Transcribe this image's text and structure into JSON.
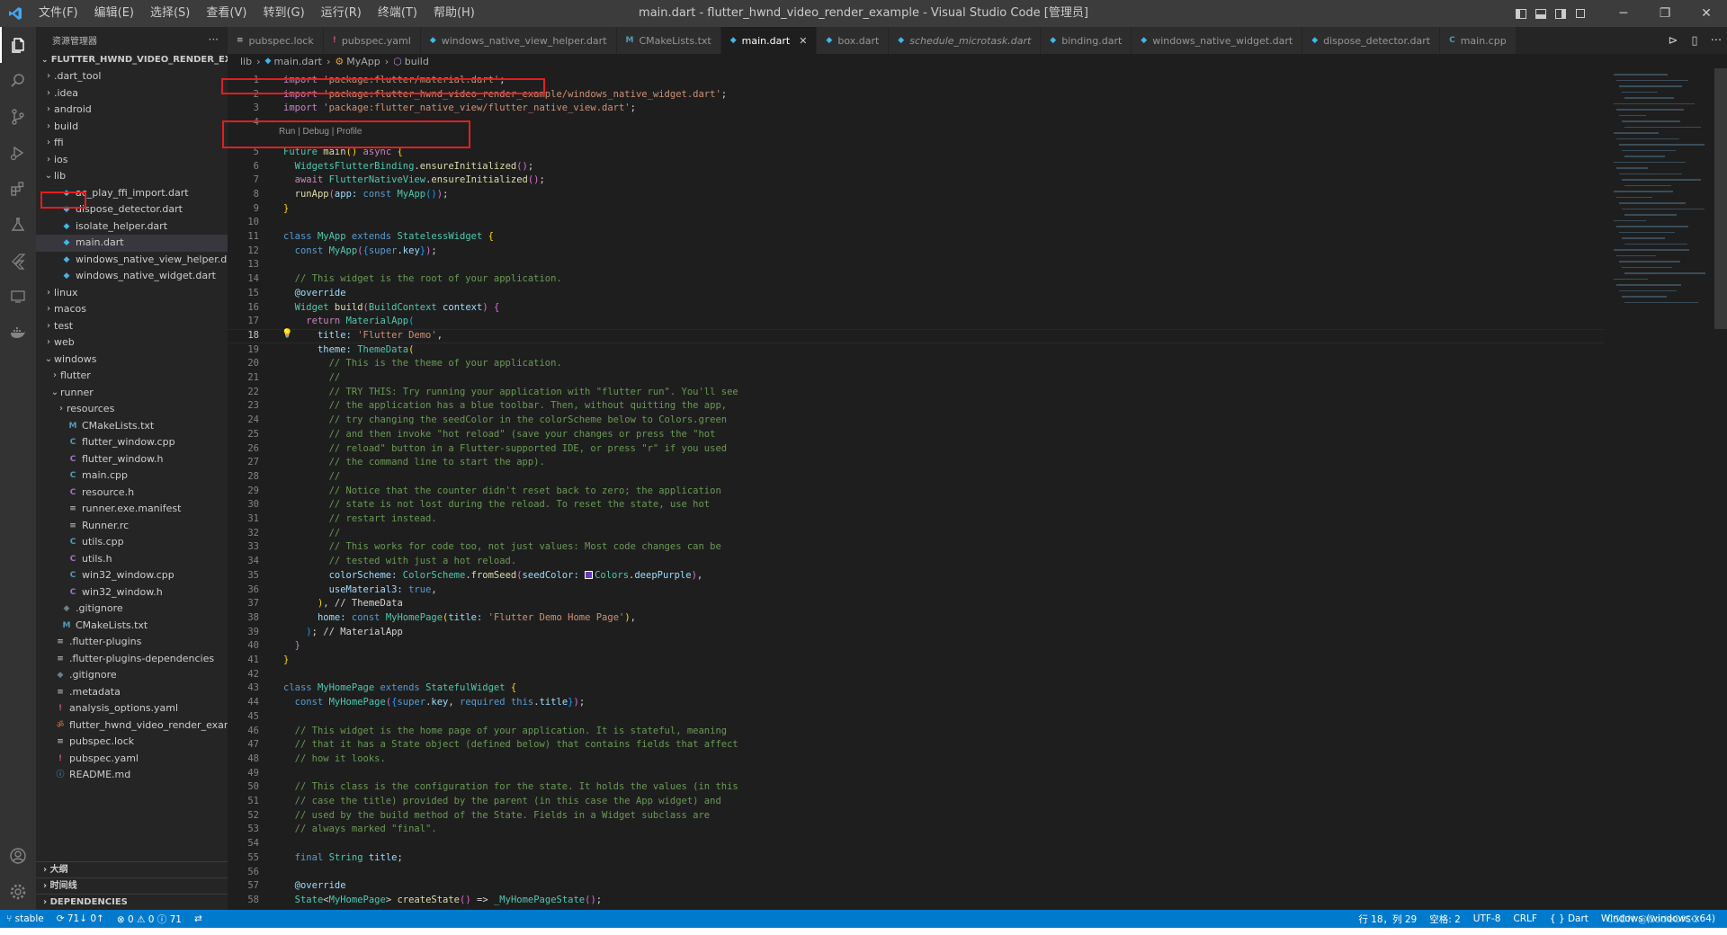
{
  "window": {
    "title": "main.dart - flutter_hwnd_video_render_example - Visual Studio Code [管理员]",
    "menu": [
      "文件(F)",
      "编辑(E)",
      "选择(S)",
      "查看(V)",
      "转到(G)",
      "运行(R)",
      "终端(T)",
      "帮助(H)"
    ],
    "controls": {
      "minimize": "─",
      "restore": "❐",
      "close": "✕"
    }
  },
  "activity_bar": {
    "top": [
      "explorer-icon",
      "search-icon",
      "source-control-icon",
      "run-debug-icon",
      "extensions-icon",
      "testing-icon",
      "flutter-icon",
      "remote-explorer-icon",
      "docker-icon"
    ],
    "bottom": [
      "account-icon",
      "settings-icon"
    ]
  },
  "sidebar": {
    "header": "资源管理器",
    "header_action": "···",
    "root": "FLUTTER_HWND_VIDEO_RENDER_EXAMPLE",
    "tree": [
      {
        "label": ".dart_tool",
        "depth": 0,
        "type": "folder",
        "open": false
      },
      {
        "label": ".idea",
        "depth": 0,
        "type": "folder",
        "open": false
      },
      {
        "label": "android",
        "depth": 0,
        "type": "folder",
        "open": false
      },
      {
        "label": "build",
        "depth": 0,
        "type": "folder",
        "open": false
      },
      {
        "label": "ffi",
        "depth": 0,
        "type": "folder",
        "open": false
      },
      {
        "label": "ios",
        "depth": 0,
        "type": "folder",
        "open": false
      },
      {
        "label": "lib",
        "depth": 0,
        "type": "folder",
        "open": true
      },
      {
        "label": "ac_play_ffi_import.dart",
        "depth": 1,
        "type": "dart"
      },
      {
        "label": "dispose_detector.dart",
        "depth": 1,
        "type": "dart"
      },
      {
        "label": "isolate_helper.dart",
        "depth": 1,
        "type": "dart"
      },
      {
        "label": "main.dart",
        "depth": 1,
        "type": "dart",
        "selected": true
      },
      {
        "label": "windows_native_view_helper.dart",
        "depth": 1,
        "type": "dart"
      },
      {
        "label": "windows_native_widget.dart",
        "depth": 1,
        "type": "dart"
      },
      {
        "label": "linux",
        "depth": 0,
        "type": "folder",
        "open": false
      },
      {
        "label": "macos",
        "depth": 0,
        "type": "folder",
        "open": false
      },
      {
        "label": "test",
        "depth": 0,
        "type": "folder",
        "open": false
      },
      {
        "label": "web",
        "depth": 0,
        "type": "folder",
        "open": false
      },
      {
        "label": "windows",
        "depth": 0,
        "type": "folder",
        "open": true
      },
      {
        "label": "flutter",
        "depth": 1,
        "type": "folder",
        "open": false
      },
      {
        "label": "runner",
        "depth": 1,
        "type": "folder",
        "open": true
      },
      {
        "label": "resources",
        "depth": 2,
        "type": "folder",
        "open": false
      },
      {
        "label": "CMakeLists.txt",
        "depth": 2,
        "type": "cmake"
      },
      {
        "label": "flutter_window.cpp",
        "depth": 2,
        "type": "cpp"
      },
      {
        "label": "flutter_window.h",
        "depth": 2,
        "type": "h"
      },
      {
        "label": "main.cpp",
        "depth": 2,
        "type": "cpp"
      },
      {
        "label": "resource.h",
        "depth": 2,
        "type": "h"
      },
      {
        "label": "runner.exe.manifest",
        "depth": 2,
        "type": "txt"
      },
      {
        "label": "Runner.rc",
        "depth": 2,
        "type": "txt"
      },
      {
        "label": "utils.cpp",
        "depth": 2,
        "type": "cpp"
      },
      {
        "label": "utils.h",
        "depth": 2,
        "type": "h"
      },
      {
        "label": "win32_window.cpp",
        "depth": 2,
        "type": "cpp"
      },
      {
        "label": "win32_window.h",
        "depth": 2,
        "type": "h"
      },
      {
        "label": ".gitignore",
        "depth": 1,
        "type": "git"
      },
      {
        "label": "CMakeLists.txt",
        "depth": 1,
        "type": "cmake"
      },
      {
        "label": ".flutter-plugins",
        "depth": 0,
        "type": "txt"
      },
      {
        "label": ".flutter-plugins-dependencies",
        "depth": 0,
        "type": "txt"
      },
      {
        "label": ".gitignore",
        "depth": 0,
        "type": "git"
      },
      {
        "label": ".metadata",
        "depth": 0,
        "type": "txt"
      },
      {
        "label": "analysis_options.yaml",
        "depth": 0,
        "type": "yaml"
      },
      {
        "label": "flutter_hwnd_video_render_example.i...",
        "depth": 0,
        "type": "rss"
      },
      {
        "label": "pubspec.lock",
        "depth": 0,
        "type": "txt"
      },
      {
        "label": "pubspec.yaml",
        "depth": 0,
        "type": "yaml"
      },
      {
        "label": "README.md",
        "depth": 0,
        "type": "info"
      }
    ],
    "sections": [
      "大纲",
      "时间线",
      "DEPENDENCIES"
    ]
  },
  "tabs": [
    {
      "label": "pubspec.lock",
      "icon": "txt"
    },
    {
      "label": "pubspec.yaml",
      "icon": "yaml"
    },
    {
      "label": "windows_native_view_helper.dart",
      "icon": "dart"
    },
    {
      "label": "CMakeLists.txt",
      "icon": "cmake"
    },
    {
      "label": "main.dart",
      "icon": "dart",
      "active": true
    },
    {
      "label": "box.dart",
      "icon": "dart"
    },
    {
      "label": "schedule_microtask.dart",
      "icon": "dart",
      "italic": true
    },
    {
      "label": "binding.dart",
      "icon": "dart"
    },
    {
      "label": "windows_native_widget.dart",
      "icon": "dart"
    },
    {
      "label": "dispose_detector.dart",
      "icon": "dart"
    },
    {
      "label": "main.cpp",
      "icon": "cpp"
    }
  ],
  "breadcrumb": [
    "lib",
    "main.dart",
    "MyApp",
    "build"
  ],
  "editor": {
    "codelens": "Run | Debug | Profile",
    "current_line": 18,
    "lines": [
      {
        "n": 1,
        "html": "<span class=\"kc\">import</span> <span class=\"s\">'package:flutter/material.dart'</span><span class=\"d\">;</span>"
      },
      {
        "n": 2,
        "html": "<span class=\"kc\">import</span> <span class=\"s\">'package:flutter_hwnd_video_render_example/windows_native_widget.dart'</span><span class=\"d\">;</span>"
      },
      {
        "n": 3,
        "html": "<span class=\"kc\">import</span> <span class=\"s\">'package:flutter_native_view/flutter_native_view.dart'</span><span class=\"d\">;</span>"
      },
      {
        "n": 4,
        "html": ""
      },
      {
        "n": 5,
        "html": "<span class=\"t\">Future</span> <span class=\"f\">main</span><span class=\"b1\">()</span> <span class=\"kc\">async</span> <span class=\"b1\">{</span>"
      },
      {
        "n": 6,
        "html": "  <span class=\"t\">WidgetsFlutterBinding</span><span class=\"d\">.</span><span class=\"f\">ensureInitialized</span><span class=\"b2\">()</span><span class=\"d\">;</span>"
      },
      {
        "n": 7,
        "html": "  <span class=\"kc\">await</span> <span class=\"t\">FlutterNativeView</span><span class=\"d\">.</span><span class=\"f\">ensureInitialized</span><span class=\"b2\">()</span><span class=\"d\">;</span>"
      },
      {
        "n": 8,
        "html": "  <span class=\"f\">runApp</span><span class=\"b2\">(</span><span class=\"p\">app:</span> <span class=\"k\">const</span> <span class=\"t\">MyApp</span><span class=\"b3\">()</span><span class=\"b2\">)</span><span class=\"d\">;</span>"
      },
      {
        "n": 9,
        "html": "<span class=\"b1\">}</span>"
      },
      {
        "n": 10,
        "html": ""
      },
      {
        "n": 11,
        "html": "<span class=\"k\">class</span> <span class=\"t\">MyApp</span> <span class=\"k\">extends</span> <span class=\"t\">StatelessWidget</span> <span class=\"b1\">{</span>"
      },
      {
        "n": 12,
        "html": "  <span class=\"k\">const</span> <span class=\"t\">MyApp</span><span class=\"b2\">(</span><span class=\"b3\">{</span><span class=\"k\">super</span><span class=\"d\">.</span><span class=\"p\">key</span><span class=\"b3\">}</span><span class=\"b2\">)</span><span class=\"d\">;</span>"
      },
      {
        "n": 13,
        "html": ""
      },
      {
        "n": 14,
        "html": "  <span class=\"c\">// This widget is the root of your application.</span>"
      },
      {
        "n": 15,
        "html": "  <span class=\"p\">@override</span>"
      },
      {
        "n": 16,
        "html": "  <span class=\"t\">Widget</span> <span class=\"f\">build</span><span class=\"b2\">(</span><span class=\"t\">BuildContext</span> <span class=\"p\">context</span><span class=\"b2\">)</span> <span class=\"b2\">{</span>"
      },
      {
        "n": 17,
        "html": "    <span class=\"kc\">return</span> <span class=\"t\">MaterialApp</span><span class=\"b3\">(</span>"
      },
      {
        "n": 18,
        "html": "      <span class=\"p\">title:</span> <span class=\"s\">'Flutter Demo'</span><span class=\"d\">,</span>"
      },
      {
        "n": 19,
        "html": "      <span class=\"p\">theme:</span> <span class=\"t\">ThemeData</span><span class=\"b1\">(</span>"
      },
      {
        "n": 20,
        "html": "        <span class=\"c\">// This is the theme of your application.</span>"
      },
      {
        "n": 21,
        "html": "        <span class=\"c\">//</span>"
      },
      {
        "n": 22,
        "html": "        <span class=\"c\">// TRY THIS: Try running your application with \"flutter run\". You'll see</span>"
      },
      {
        "n": 23,
        "html": "        <span class=\"c\">// the application has a blue toolbar. Then, without quitting the app,</span>"
      },
      {
        "n": 24,
        "html": "        <span class=\"c\">// try changing the seedColor in the colorScheme below to Colors.green</span>"
      },
      {
        "n": 25,
        "html": "        <span class=\"c\">// and then invoke \"hot reload\" (save your changes or press the \"hot</span>"
      },
      {
        "n": 26,
        "html": "        <span class=\"c\">// reload\" button in a Flutter-supported IDE, or press \"r\" if you used</span>"
      },
      {
        "n": 27,
        "html": "        <span class=\"c\">// the command line to start the app).</span>"
      },
      {
        "n": 28,
        "html": "        <span class=\"c\">//</span>"
      },
      {
        "n": 29,
        "html": "        <span class=\"c\">// Notice that the counter didn't reset back to zero; the application</span>"
      },
      {
        "n": 30,
        "html": "        <span class=\"c\">// state is not lost during the reload. To reset the state, use hot</span>"
      },
      {
        "n": 31,
        "html": "        <span class=\"c\">// restart instead.</span>"
      },
      {
        "n": 32,
        "html": "        <span class=\"c\">//</span>"
      },
      {
        "n": 33,
        "html": "        <span class=\"c\">// This works for code too, not just values: Most code changes can be</span>"
      },
      {
        "n": 34,
        "html": "        <span class=\"c\">// tested with just a hot reload.</span>"
      },
      {
        "n": 35,
        "html": "        <span class=\"p\">colorScheme:</span> <span class=\"t\">ColorScheme</span><span class=\"d\">.</span><span class=\"f\">fromSeed</span><span class=\"b2\">(</span><span class=\"p\">seedColor:</span> <span class=\"swatch\"></span><span class=\"t\">Colors</span><span class=\"d\">.</span><span class=\"p\">deepPurple</span><span class=\"b2\">)</span><span class=\"d\">,</span>"
      },
      {
        "n": 36,
        "html": "        <span class=\"p\">useMaterial3:</span> <span class=\"k\">true</span><span class=\"d\">,</span>"
      },
      {
        "n": 37,
        "html": "      <span class=\"b1\">)</span><span class=\"d\">,</span> <span class=\"d\">// ThemeData</span>"
      },
      {
        "n": 38,
        "html": "      <span class=\"p\">home:</span> <span class=\"k\">const</span> <span class=\"t\">MyHomePage</span><span class=\"b1\">(</span><span class=\"p\">title:</span> <span class=\"s\">'Flutter Demo Home Page'</span><span class=\"b1\">)</span><span class=\"d\">,</span>"
      },
      {
        "n": 39,
        "html": "    <span class=\"b3\">)</span><span class=\"d\">;</span> <span class=\"d\">// MaterialApp</span>"
      },
      {
        "n": 40,
        "html": "  <span class=\"b2\">}</span>"
      },
      {
        "n": 41,
        "html": "<span class=\"b1\">}</span>"
      },
      {
        "n": 42,
        "html": ""
      },
      {
        "n": 43,
        "html": "<span class=\"k\">class</span> <span class=\"t\">MyHomePage</span> <span class=\"k\">extends</span> <span class=\"t\">StatefulWidget</span> <span class=\"b1\">{</span>"
      },
      {
        "n": 44,
        "html": "  <span class=\"k\">const</span> <span class=\"t\">MyHomePage</span><span class=\"b2\">(</span><span class=\"b3\">{</span><span class=\"k\">super</span><span class=\"d\">.</span><span class=\"p\">key</span><span class=\"d\">,</span> <span class=\"k\">required</span> <span class=\"k\">this</span><span class=\"d\">.</span><span class=\"p\">title</span><span class=\"b3\">}</span><span class=\"b2\">)</span><span class=\"d\">;</span>"
      },
      {
        "n": 45,
        "html": ""
      },
      {
        "n": 46,
        "html": "  <span class=\"c\">// This widget is the home page of your application. It is stateful, meaning</span>"
      },
      {
        "n": 47,
        "html": "  <span class=\"c\">// that it has a State object (defined below) that contains fields that affect</span>"
      },
      {
        "n": 48,
        "html": "  <span class=\"c\">// how it looks.</span>"
      },
      {
        "n": 49,
        "html": ""
      },
      {
        "n": 50,
        "html": "  <span class=\"c\">// This class is the configuration for the state. It holds the values (in this</span>"
      },
      {
        "n": 51,
        "html": "  <span class=\"c\">// case the title) provided by the parent (in this case the App widget) and</span>"
      },
      {
        "n": 52,
        "html": "  <span class=\"c\">// used by the build method of the State. Fields in a Widget subclass are</span>"
      },
      {
        "n": 53,
        "html": "  <span class=\"c\">// always marked \"final\".</span>"
      },
      {
        "n": 54,
        "html": ""
      },
      {
        "n": 55,
        "html": "  <span class=\"k\">final</span> <span class=\"t\">String</span> <span class=\"p\">title</span><span class=\"d\">;</span>"
      },
      {
        "n": 56,
        "html": ""
      },
      {
        "n": 57,
        "html": "  <span class=\"p\">@override</span>"
      },
      {
        "n": 58,
        "html": "  <span class=\"t\">State</span><span class=\"d\">&lt;</span><span class=\"t\">MyHomePage</span><span class=\"d\">&gt;</span> <span class=\"f\">createState</span><span class=\"b2\">()</span> <span class=\"d\">=&gt;</span> <span class=\"t\">_MyHomePageState</span><span class=\"b2\">()</span><span class=\"d\">;</span>"
      }
    ]
  },
  "statusbar": {
    "branch": "stable",
    "sync": "71↓ 0↑",
    "problems": "⊗ 0 ⚠ 0 ⓘ 71",
    "right": [
      "行 18，列 29",
      "空格: 2",
      "UTF-8",
      "CRLF",
      "{ } Dart",
      "Windows (windows-x64)"
    ]
  },
  "watermark": "CSDN @CodeOfCC"
}
